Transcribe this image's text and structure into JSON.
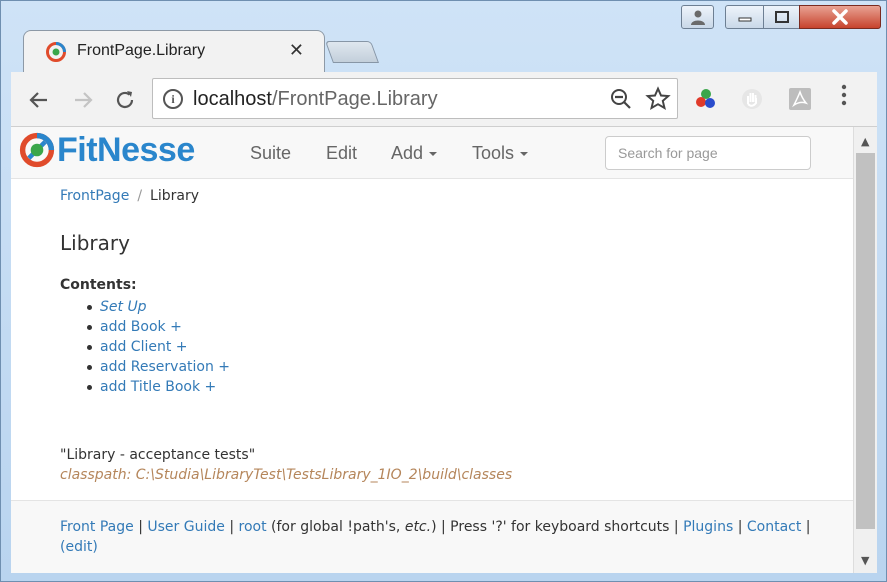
{
  "browser": {
    "tab_title": "FrontPage.Library",
    "tab_close": "✕",
    "url_host": "localhost",
    "url_path": "/FrontPage.Library"
  },
  "fitnesse": {
    "logo_text": "FitNesse",
    "nav": {
      "suite": "Suite",
      "edit": "Edit",
      "add": "Add",
      "tools": "Tools"
    },
    "search_placeholder": "Search for page"
  },
  "page": {
    "breadcrumb": {
      "root": "FrontPage",
      "separator": "/",
      "current": "Library"
    },
    "title": "Library",
    "contents_label": "Contents:",
    "contents": [
      "Set Up",
      "add Book +",
      "add Client +",
      "add Reservation +",
      "add Title Book +"
    ],
    "description": "\"Library - acceptance tests\"",
    "classpath": "classpath: C:\\Studia\\LibraryTest\\TestsLibrary_1IO_2\\build\\classes"
  },
  "footer": {
    "front_page": "Front Page",
    "user_guide": "User Guide",
    "root": "root",
    "root_note_prefix": "(for global !path's, ",
    "root_note_etc": "etc.",
    "root_note_suffix": ")",
    "press_note": "Press '?' for keyboard shortcuts",
    "plugins": "Plugins",
    "contact": "Contact",
    "edit": "(edit)",
    "sep": "|"
  },
  "colors": {
    "link": "#337ab7",
    "logo": "#2a86cc",
    "classpath": "#b5865b"
  }
}
